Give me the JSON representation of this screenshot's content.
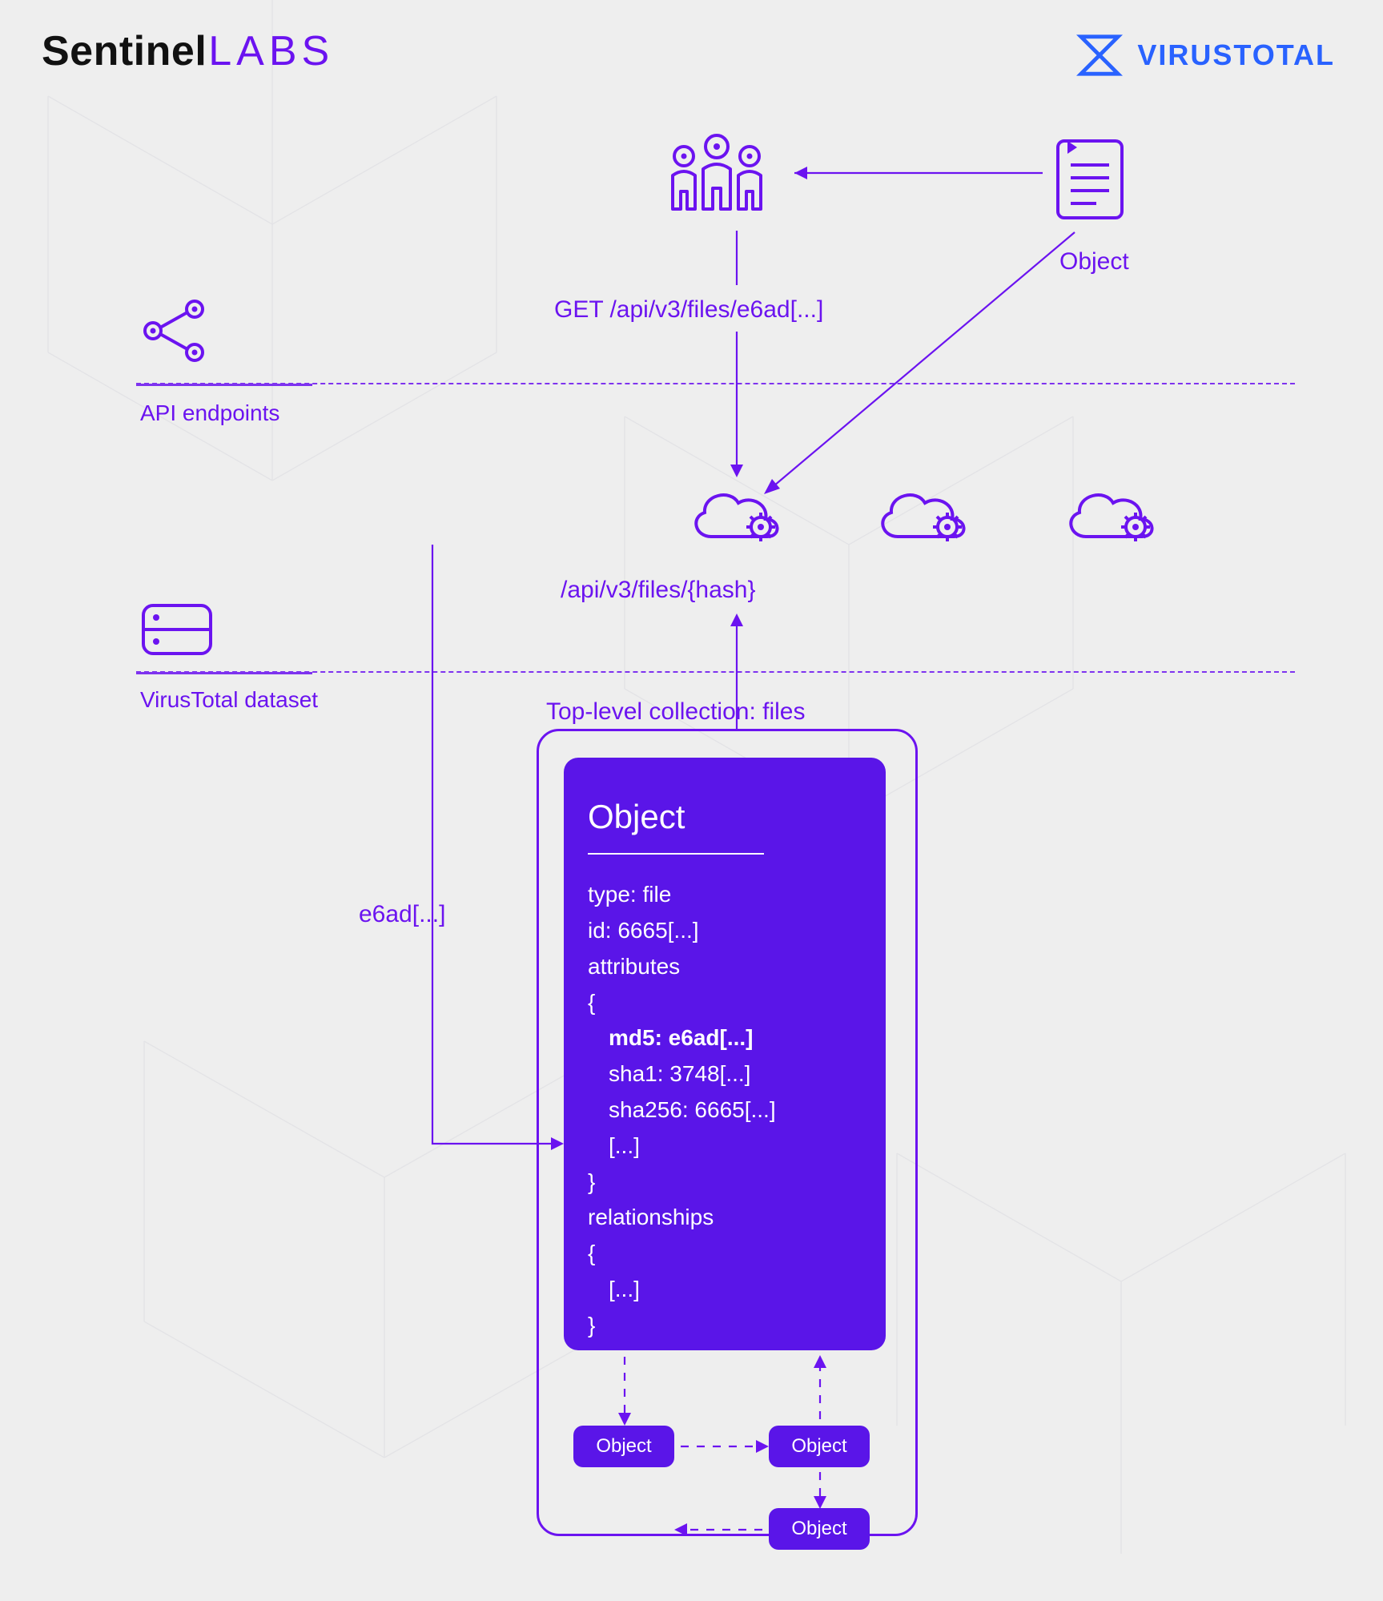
{
  "logos": {
    "sentinel_part1": "Sentinel",
    "sentinel_part2": "LABS",
    "virustotal": "VIRUSTOTAL"
  },
  "labels": {
    "api_endpoints": "API endpoints",
    "vt_dataset": "VirusTotal dataset",
    "get_request": "GET /api/v3/files/e6ad[...]",
    "object": "Object",
    "endpoint_template": "/api/v3/files/{hash}",
    "top_level_collection": "Top-level collection: files",
    "pointer": "e6ad[...]"
  },
  "card": {
    "title": "Object",
    "type_line": "type: file",
    "id_line": "id: 6665[...]",
    "attributes_label": "attributes",
    "attrs": {
      "md5": "md5: e6ad[...]",
      "sha1": "sha1: 3748[...]",
      "sha256": "sha256: 6665[...]",
      "more": "[...]"
    },
    "relationships_label": "relationships",
    "rel_more": "[...]"
  },
  "chips": {
    "label": "Object"
  }
}
